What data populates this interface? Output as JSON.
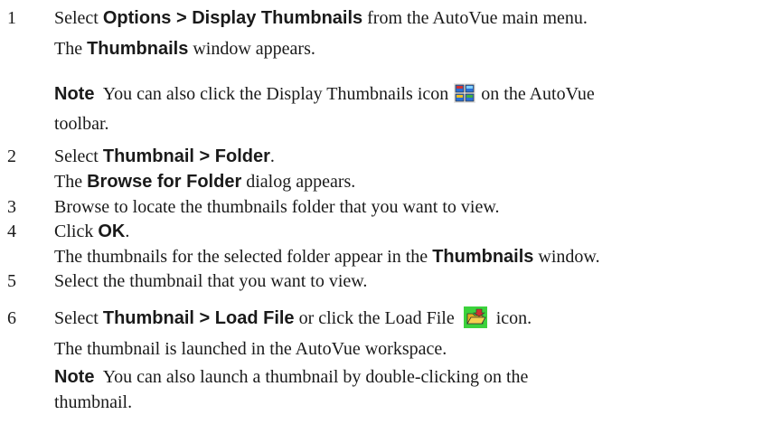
{
  "steps": [
    {
      "number": "1",
      "line1": {
        "pre": "Select ",
        "bold": "Options > Display Thumbnails",
        "post": " from the AutoVue main menu."
      },
      "line2": {
        "pre": "The ",
        "bold": "Thumbnails",
        "post": " window appears."
      },
      "note": {
        "label": "Note",
        "pre": "You can also click the Display Thumbnails icon",
        "icon": "display-thumbnails-icon",
        "post": "on the AutoVue",
        "line2": "toolbar."
      }
    },
    {
      "number": "2",
      "line1": {
        "pre": "Select ",
        "bold": "Thumbnail > Folder",
        "post": "."
      },
      "line2": {
        "pre": "The ",
        "bold": "Browse for Folder",
        "post": " dialog appears."
      }
    },
    {
      "number": "3",
      "text": "Browse to locate the thumbnails folder that you want to view."
    },
    {
      "number": "4",
      "line1": {
        "pre": "Click ",
        "bold": "OK",
        "post": "."
      },
      "line2": {
        "pre": "The thumbnails for the selected folder appear in the ",
        "bold": "Thumbnails",
        "post": " window."
      }
    },
    {
      "number": "5",
      "text": "Select the thumbnail that you want to view."
    },
    {
      "number": "6",
      "line1": {
        "pre": "Select ",
        "bold": "Thumbnail > Load File",
        "mid": " or click the Load File",
        "icon": "load-file-icon",
        "post": "icon."
      },
      "line2": "The thumbnail is launched in the AutoVue workspace.",
      "note": {
        "label": "Note",
        "text": "You can also launch a thumbnail by double-clicking on the",
        "line2": "thumbnail."
      }
    }
  ]
}
